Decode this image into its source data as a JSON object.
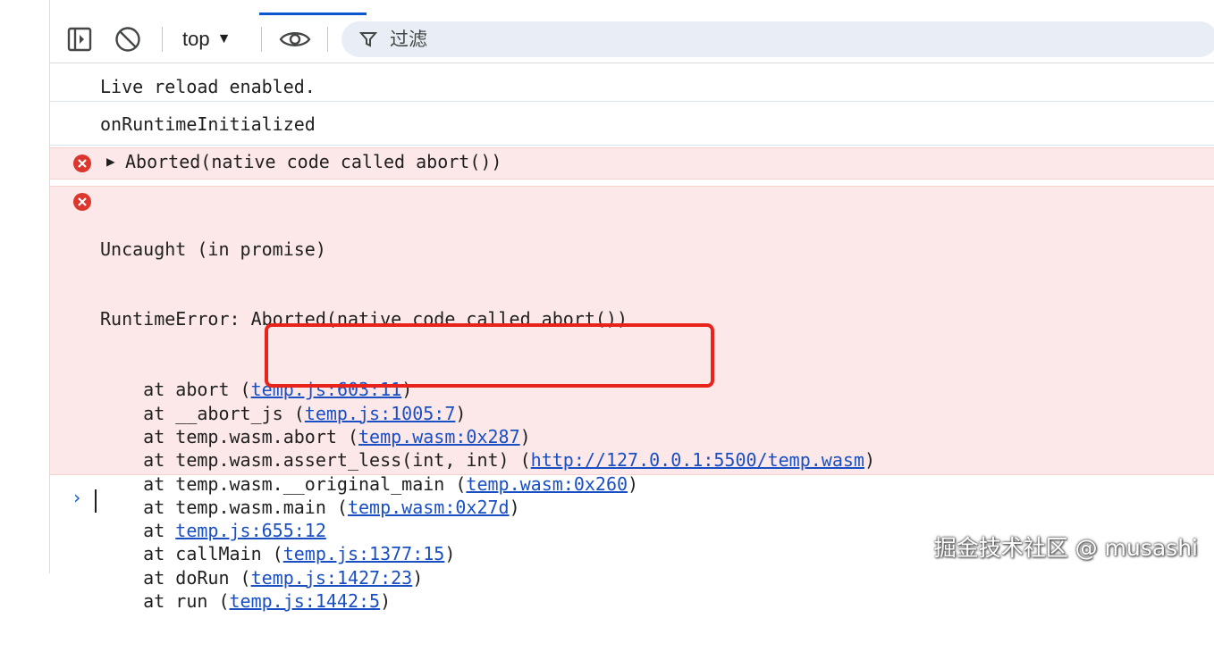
{
  "toolbar": {
    "context": "top",
    "filter_placeholder": "过滤"
  },
  "console": {
    "messages": [
      {
        "type": "log",
        "text": "Live reload enabled."
      },
      {
        "type": "log",
        "text": "onRuntimeInitialized"
      },
      {
        "type": "error",
        "text": "Aborted(native code called abort())"
      }
    ],
    "uncaught": {
      "header": "Uncaught (in promise)",
      "error": "RuntimeError: Aborted(native code called abort())",
      "frames": [
        {
          "fn": "abort",
          "loc": "temp.js:603:11"
        },
        {
          "fn": "__abort_js",
          "loc": "temp.js:1005:7"
        },
        {
          "fn": "temp.wasm.abort",
          "loc": "temp.wasm:0x287"
        },
        {
          "fn": "temp.wasm.assert_less(int, int)",
          "loc": "http://127.0.0.1:5500/temp.wasm"
        },
        {
          "fn": "temp.wasm.__original_main",
          "loc": "temp.wasm:0x260"
        },
        {
          "fn": "temp.wasm.main",
          "loc": "temp.wasm:0x27d"
        },
        {
          "fn": "",
          "loc": "temp.js:655:12"
        },
        {
          "fn": "callMain",
          "loc": "temp.js:1377:15"
        },
        {
          "fn": "doRun",
          "loc": "temp.js:1427:23"
        },
        {
          "fn": "run",
          "loc": "temp.js:1442:5"
        }
      ]
    },
    "prompt_symbol": "›"
  },
  "watermark": "掘金技术社区 @ musashi",
  "colors": {
    "error_bg": "#fce8e8",
    "link": "#1a4fc4",
    "highlight": "#e8231c",
    "filter_bg": "#e9eef6"
  }
}
